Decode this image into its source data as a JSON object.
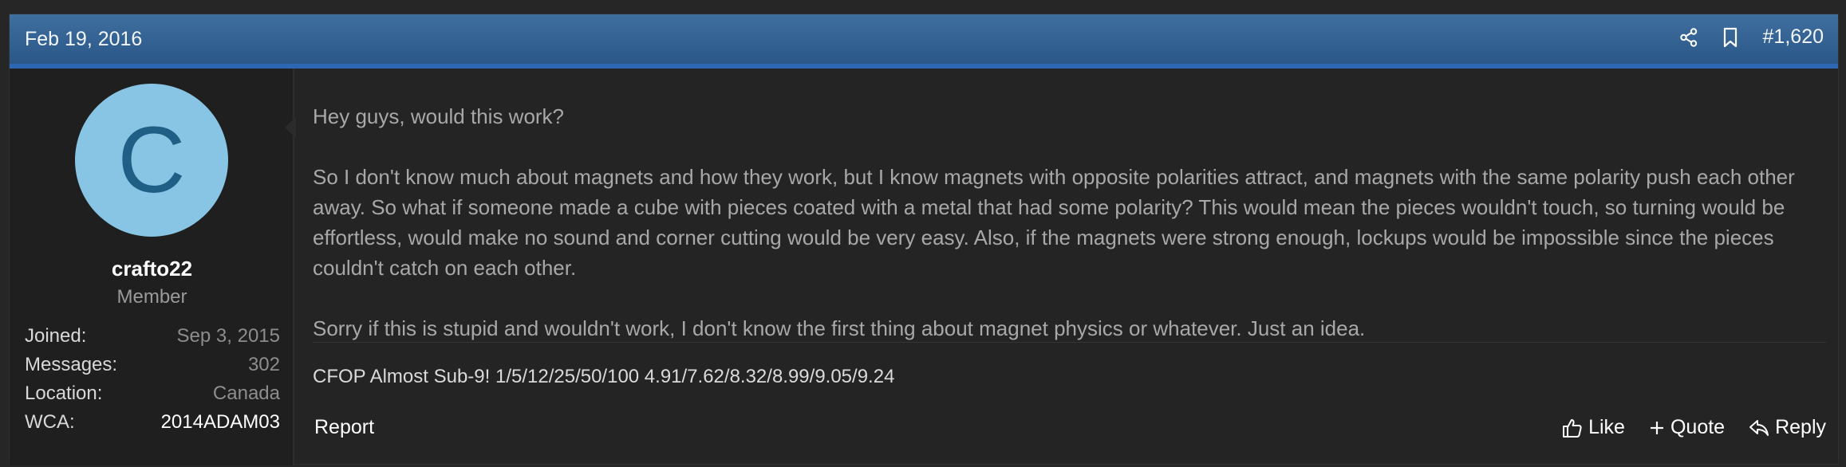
{
  "header": {
    "date": "Feb 19, 2016",
    "post_number": "#1,620",
    "icons": [
      "share-icon",
      "bookmark-icon"
    ]
  },
  "user": {
    "avatar_letter": "C",
    "avatar_color": "#88c4e3",
    "username": "crafto22",
    "title": "Member",
    "stats": [
      {
        "label": "Joined:",
        "value": "Sep 3, 2015"
      },
      {
        "label": "Messages:",
        "value": "302"
      },
      {
        "label": "Location:",
        "value": "Canada"
      },
      {
        "label": "WCA:",
        "value": "2014ADAM03"
      }
    ]
  },
  "message": {
    "paragraphs": [
      "Hey guys, would this work?",
      "So I don't know much about magnets and how they work, but I know magnets with opposite polarities attract, and magnets with the same polarity push each other away. So what if someone made a cube with pieces coated with a metal that had some polarity? This would mean the pieces wouldn't touch, so turning would be effortless, would make no sound and corner cutting would be very easy. Also, if the magnets were strong enough, lockups would be impossible since the pieces couldn't catch on each other.",
      "Sorry if this is stupid and wouldn't work, I don't know the first thing about magnet physics or whatever. Just an idea."
    ],
    "signature": "CFOP Almost Sub-9! 1/5/12/25/50/100 4.91/7.62/8.32/8.99/9.05/9.24"
  },
  "footer": {
    "report": "Report",
    "like": "Like",
    "quote": "Quote",
    "reply": "Reply"
  },
  "colors": {
    "header_gradient_top": "#3f6f9f",
    "header_gradient_bottom": "#2a5788",
    "accent_bar": "#2d67b4",
    "background": "#242424",
    "user_panel": "#1f1f1f"
  }
}
